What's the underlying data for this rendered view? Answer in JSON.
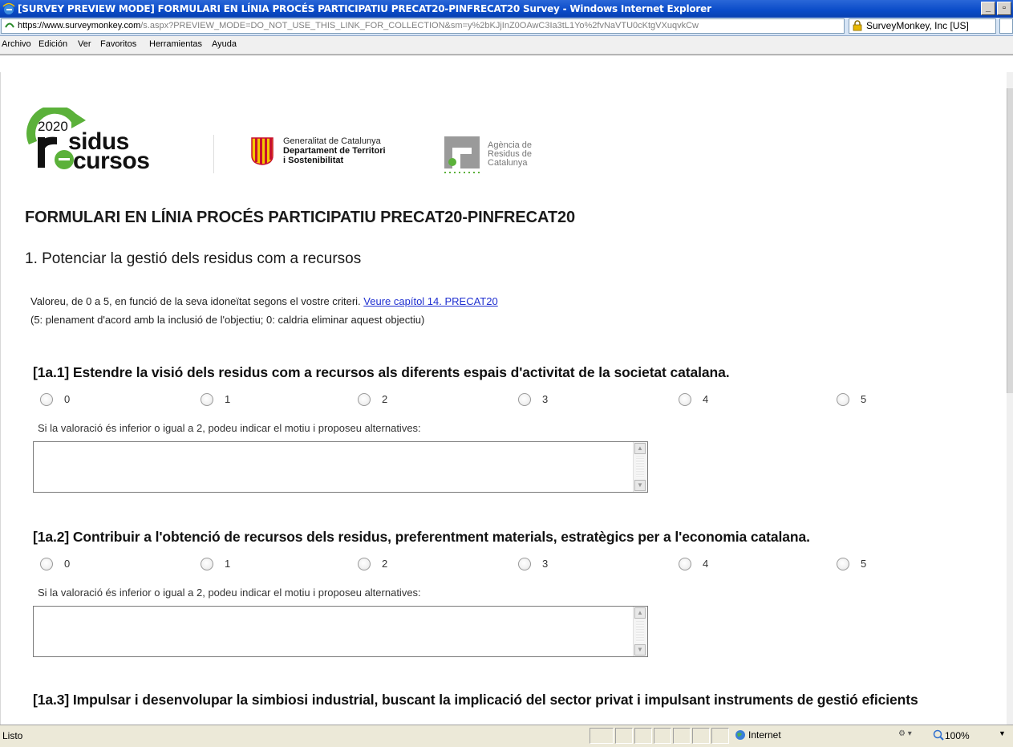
{
  "window": {
    "title": "[SURVEY PREVIEW MODE] FORMULARI EN LÍNIA PROCÉS PARTICIPATIU PRECAT20-PINFRECAT20 Survey - Windows Internet Explorer",
    "minimize": "_",
    "restore": "🗗"
  },
  "address": {
    "scheme": "https://",
    "domain": "www.surveymonkey.com",
    "path": "/s.aspx?PREVIEW_MODE=DO_NOT_USE_THIS_LINK_FOR_COLLECTION&sm=y%2bKJjInZ0OAwC3Ia3tL1Yo%2fvNaVTU0cKtgVXuqvkCw",
    "cert": "SurveyMonkey, Inc [US]"
  },
  "menu": [
    "Archivo",
    "Edición",
    "Ver",
    "Favoritos",
    "Herramientas",
    "Ayuda"
  ],
  "logos": {
    "residus_year": "2020",
    "residus_line1": "sidus",
    "residus_line2": "cursos",
    "gen_line1": "Generalitat de Catalunya",
    "gen_line2": "Departament de Territori",
    "gen_line3": "i Sostenibilitat",
    "arc_line1": "Agència de",
    "arc_line2": "Residus de",
    "arc_line3": "Catalunya"
  },
  "survey": {
    "title": "FORMULARI EN LÍNIA PROCÉS PARTICIPATIU PRECAT20-PINFRECAT20",
    "section": "1. Potenciar la gestió dels residus com a recursos",
    "instruction_text": "Valoreu, de 0 a 5, en funció de la seva idoneïtat segons el vostre criteri. ",
    "instruction_link": "Veure capítol 14. PRECAT20",
    "instruction_note": "(5: plenament d'acord amb la inclusió de l'objectiu; 0: caldria eliminar aquest objectiu)",
    "options": [
      "0",
      "1",
      "2",
      "3",
      "4",
      "5"
    ],
    "comment_label": "Si la valoració és inferior o igual a 2, podeu indicar el motiu i proposeu alternatives:",
    "questions": [
      {
        "title": "[1a.1] Estendre la visió dels residus com a recursos als diferents espais d'activitat de la societat catalana."
      },
      {
        "title": "[1a.2] Contribuir a l'obtenció de recursos dels residus, preferentment materials, estratègics per a l'economia catalana."
      },
      {
        "title": "[1a.3] Impulsar i desenvolupar la simbiosi industrial, buscant la implicació del sector privat i impulsant instruments de gestió eficients"
      }
    ]
  },
  "status": {
    "text": "Listo",
    "zone": "Internet",
    "zoom": "100%"
  },
  "colors": {
    "titlebar": "#0a4bc8",
    "link": "#1f2fd0",
    "logo_green": "#5bb13a",
    "gencat_red": "#c8102e"
  }
}
